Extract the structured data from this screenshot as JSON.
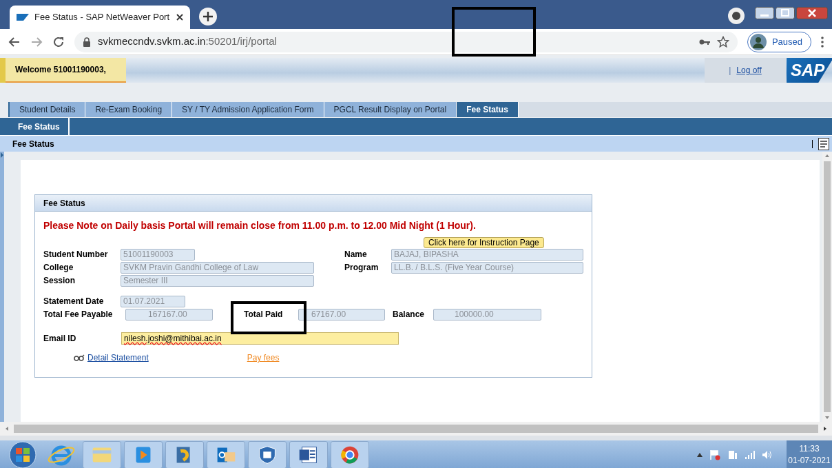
{
  "browser": {
    "tab_title": "Fee Status - SAP NetWeaver Port",
    "url_host": "svkmeccndv.svkm.ac.in",
    "url_rest": ":50201/irj/portal",
    "profile_label": "Paused"
  },
  "header": {
    "welcome": "Welcome 51001190003,",
    "separator": "|",
    "logoff": "Log off",
    "logo": "SAP"
  },
  "tabs": [
    {
      "label": "Student Details",
      "selected": false
    },
    {
      "label": "Re-Exam Booking",
      "selected": false
    },
    {
      "label": "SY / TY Admission Application Form",
      "selected": false
    },
    {
      "label": "PGCL Result Display on Portal",
      "selected": false
    },
    {
      "label": "Fee Status",
      "selected": true
    }
  ],
  "subtabs": [
    {
      "label": "Fee Status",
      "selected": true
    }
  ],
  "page_title": "Fee Status",
  "panel": {
    "title": "Fee Status",
    "notice": "Please Note on Daily basis Portal will remain close from 11.00 p.m. to 12.00 Mid Night (1 Hour).",
    "instruction_button": "Click here for Instruction Page",
    "student_number": {
      "label": "Student Number",
      "value": "51001190003"
    },
    "name": {
      "label": "Name",
      "value": "BAJAJ, BIPASHA"
    },
    "college": {
      "label": "College",
      "value": "SVKM Pravin Gandhi College of Law"
    },
    "program": {
      "label": "Program",
      "value": "LL.B. / B.L.S. (Five Year Course)"
    },
    "session": {
      "label": "Session",
      "value": "Semester III"
    },
    "statement_date": {
      "label": "Statement Date",
      "value": "01.07.2021"
    },
    "total_fee_payable": {
      "label": "Total Fee Payable",
      "value": "167167.00"
    },
    "total_paid": {
      "label": "Total Paid",
      "value": "67167.00"
    },
    "balance": {
      "label": "Balance",
      "value": "100000.00"
    },
    "email": {
      "label": "Email ID",
      "value": "nilesh.joshi@mithibai.ac.in"
    },
    "detail_link": "Detail Statement",
    "pay_link": "Pay fees"
  },
  "taskbar": {
    "time": "11:33",
    "date": "01-07-2021"
  }
}
